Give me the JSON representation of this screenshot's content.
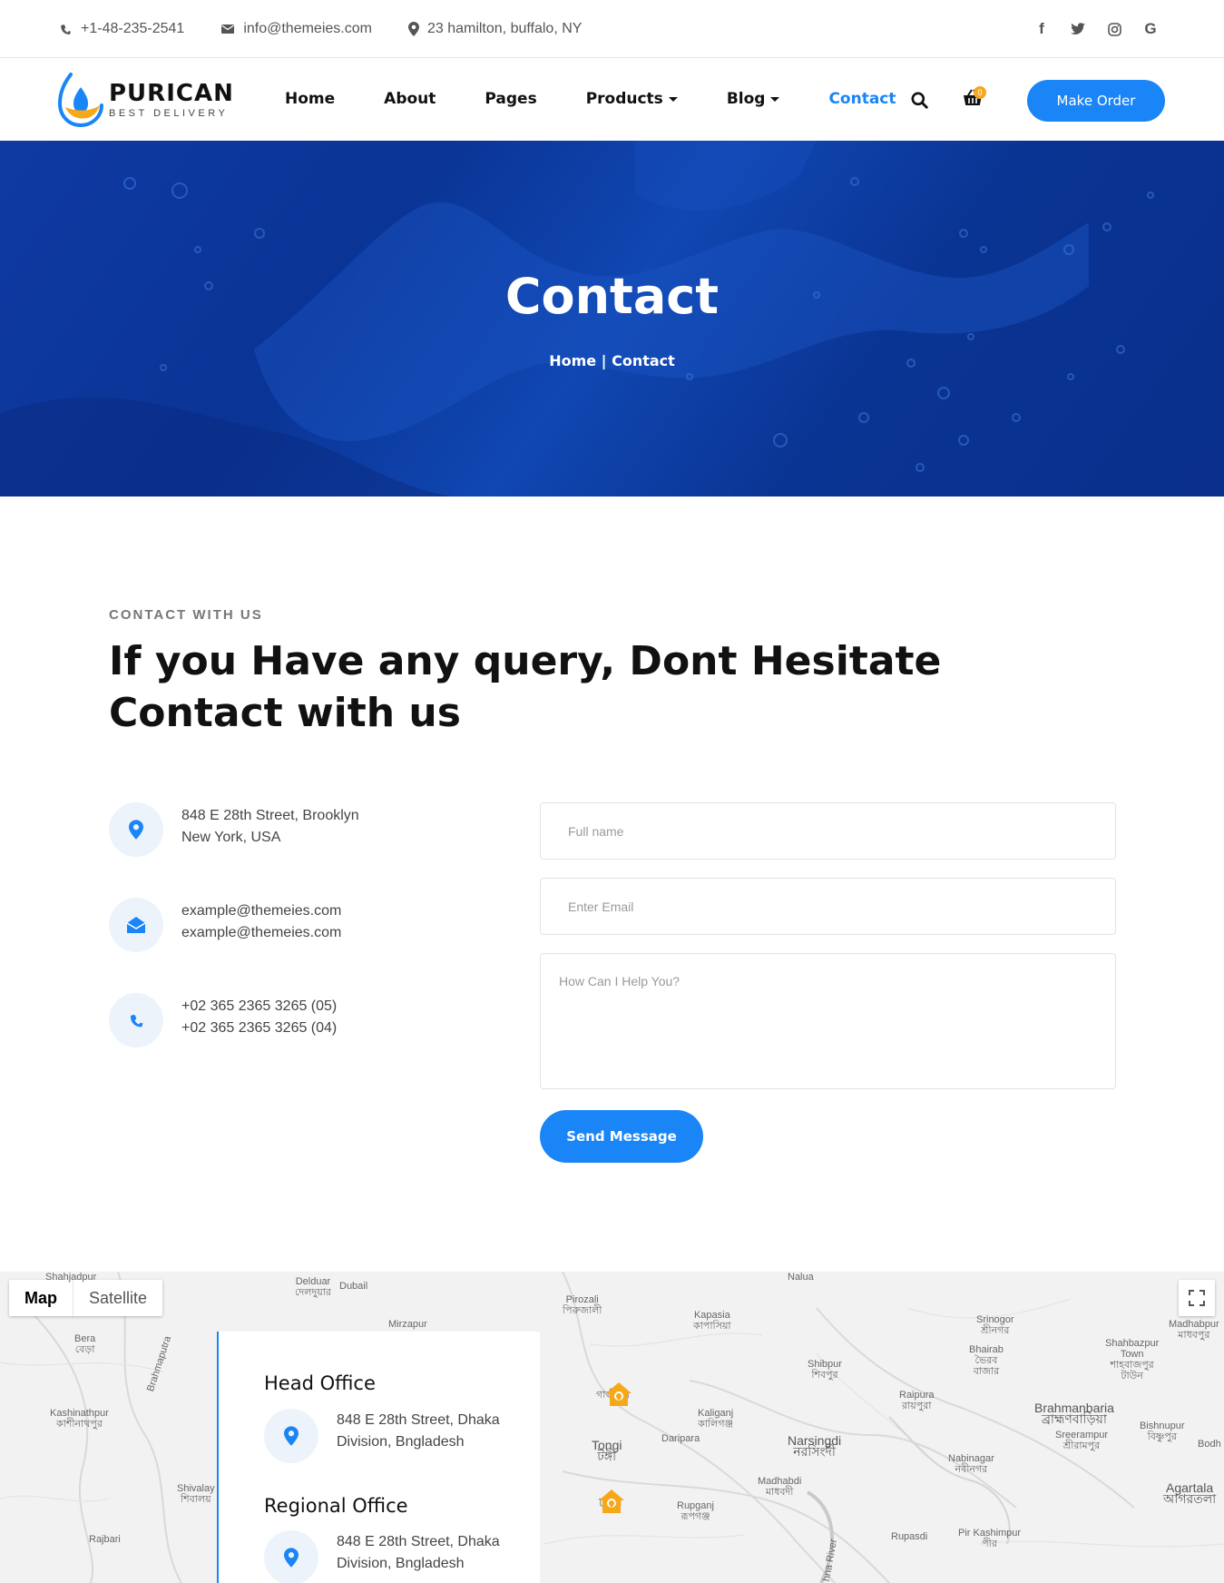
{
  "topbar": {
    "phone": "+1-48-235-2541",
    "email": "info@themeies.com",
    "address": "23 hamilton, buffalo, NY",
    "socials": [
      "facebook-icon",
      "twitter-icon",
      "instagram-icon",
      "google-icon"
    ]
  },
  "brand": {
    "name": "PURICAN",
    "tagline": "BEST DELIVERY",
    "accent": "#1a85f7",
    "highlight": "#f7a71a"
  },
  "nav": {
    "items": [
      {
        "label": "Home"
      },
      {
        "label": "About"
      },
      {
        "label": "Pages"
      },
      {
        "label": "Products"
      },
      {
        "label": "Blog"
      },
      {
        "label": "Contact"
      }
    ],
    "cart_count": "0",
    "order_label": "Make Order"
  },
  "hero": {
    "title": "Contact",
    "crumb_home": "Home",
    "crumb_sep": "|",
    "crumb_current": "Contact"
  },
  "contact": {
    "eyebrow": "CONTACT WITH US",
    "headline_line1": "If you Have any query, Dont Hesitate",
    "headline_line2": "Contact with us",
    "address": [
      "848 E 28th Street, Brooklyn",
      "New York, USA"
    ],
    "emails": [
      "example@themeies.com",
      "example@themeies.com"
    ],
    "phones": [
      "+02 365 2365 3265 (05)",
      "+02 365 2365 3265 (04)"
    ]
  },
  "form": {
    "name_placeholder": "Full name",
    "email_placeholder": "Enter Email",
    "message_placeholder": "How Can I Help You?",
    "send_label": "Send Message"
  },
  "map": {
    "tab_map": "Map",
    "tab_satellite": "Satellite",
    "places": {
      "shahjadpur": "Shahjadpur",
      "delduar": "Delduar",
      "delduar_bn": "দেলদুয়ার",
      "dubail": "Dubail",
      "mirzapur": "Mirzapur",
      "pirozali": "Pirozali",
      "pirozali_bn": "পিরুজালী",
      "kapasia": "Kapasia",
      "kapasia_bn": "কাপাসিয়া",
      "srinogor": "Srinogor",
      "srinogor_bn": "শ্রীনগর",
      "madhabpur": "Madhabpur",
      "madhabpur_bn": "মাধবপুর",
      "bera": "Bera",
      "bera_bn": "বেড়া",
      "shahbazpur": "Shahbazpur",
      "town": "Town",
      "shahbazpur_bn": "শাহবাজপুর",
      "town_bn": "টাউন",
      "bhairab": "Bhairab",
      "bhairab_bn1": "ভৈরব",
      "bhairab_bn2": "বাজার",
      "shibpur": "Shibpur",
      "shibpur_bn": "শিবপুর",
      "gazipur_bn": "গাজীপুর",
      "raipura": "Raipura",
      "raipura_bn": "রায়পুরা",
      "kashinathpur": "Kashinathpur",
      "kashinathpur_bn": "কাশীনাথপুর",
      "brahmaputra": "Brahmaputra",
      "kaliganj": "Kaliganj",
      "kaliganj_bn": "কালিগঞ্জ",
      "daripara": "Daripara",
      "brahmanbaria": "Brahmanbaria",
      "brahmanbaria_bn": "ব্রাহ্মণবাড়িয়া",
      "sreerampur": "Sreerampur",
      "sreerampur_bn": "শ্রীরামপুর",
      "bishnupur": "Bishnupur",
      "bishnupur_bn": "বিষ্ণুপুর",
      "tongi": "Tongi",
      "tongi_bn": "টঙ্গী",
      "narsingdi": "Narsingdi",
      "narsingdi_bn": "নরসিংদী",
      "nabinagar": "Nabinagar",
      "nabinagar_bn": "নবীনগর",
      "shivalay": "Shivalay",
      "shivalay_bn": "শিবালয়",
      "madhabdi": "Madhabdi",
      "madhabdi_bn": "মাধবদী",
      "dhaka_bn": "ঢাকা",
      "agartala": "Agartala",
      "agartala_bn": "আগরতলা",
      "rupganj": "Rupganj",
      "rupganj_bn": "রূপগঞ্জ",
      "rajbari": "Rajbari",
      "rupasdi": "Rupasdi",
      "pir_kashimpur": "Pir Kashimpur",
      "pir_bn": "পীর",
      "meghna_river": "hna River",
      "nalua": "Nalua",
      "bodh": "Bodh"
    },
    "head_office_title": "Head Office",
    "head_office_address": [
      "848 E 28th Street, Dhaka",
      "Division, Bngladesh"
    ],
    "regional_office_title": "Regional Office",
    "regional_office_address": [
      "848 E 28th Street, Dhaka",
      "Division, Bngladesh"
    ]
  }
}
